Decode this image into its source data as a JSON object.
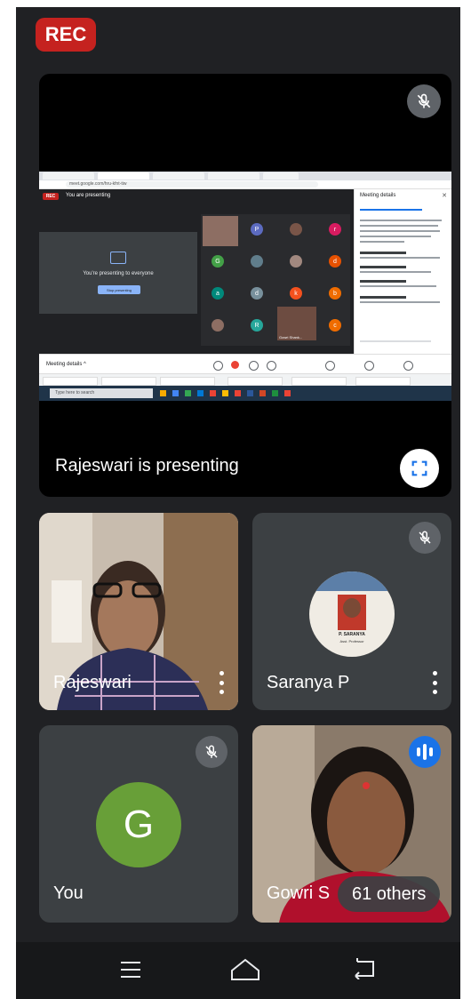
{
  "rec_label": "REC",
  "presentation": {
    "caption": "Rajeswari is presenting",
    "mic_icon": "mic-off-icon",
    "fullscreen_icon": "fullscreen-icon",
    "shared_screen": {
      "rec_label": "REC",
      "presenting_label": "You are presenting",
      "url": "meet.google.com/hru-kfnt-tiw",
      "presenting_text": "You're presenting to everyone",
      "stop_label": "Stop presenting",
      "side_title": "Meeting details",
      "footer_label": "Meeting details ^",
      "taskbar_search": "Type here to search",
      "grid_letters": [
        "P",
        "r",
        "G",
        "d",
        "a",
        "d",
        "k",
        "b",
        "R",
        "c"
      ],
      "self_label": "Gowri Shank..."
    }
  },
  "tiles": [
    {
      "name": "Rajeswari",
      "kind": "video",
      "has_menu": true
    },
    {
      "name": "Saranya P",
      "kind": "avatar-photo",
      "muted": true,
      "has_menu": true,
      "badge_lines": [
        "P. SARANYA",
        "Asst. Professor"
      ]
    },
    {
      "name": "You",
      "kind": "initial",
      "initial": "G",
      "muted": true
    },
    {
      "name": "Gowri S",
      "kind": "video",
      "speaking_icon": "audio-wave-icon",
      "others_label": "61 others"
    }
  ],
  "colors": {
    "rec": "#c5221f",
    "tile_bg": "#3c4043",
    "you_avatar": "#689f38",
    "speaking": "#1a73e8"
  },
  "navbar": {
    "menu_icon": "menu-icon",
    "home_icon": "home-icon",
    "back_icon": "back-icon"
  }
}
